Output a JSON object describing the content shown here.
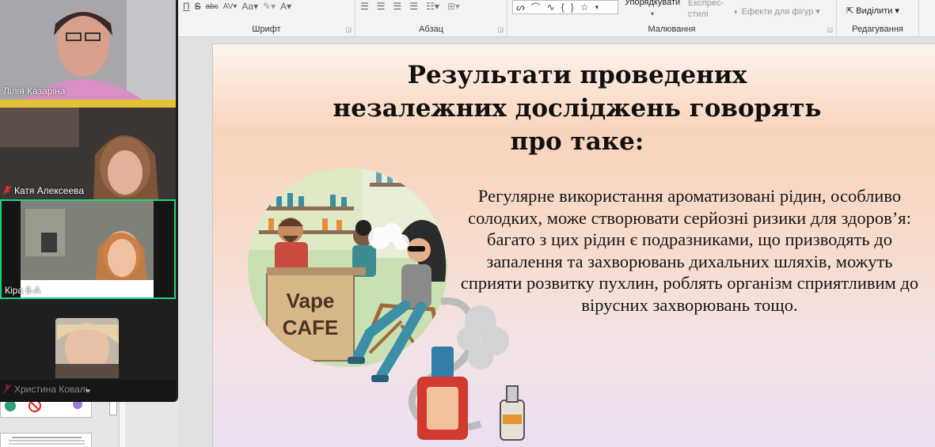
{
  "ribbon": {
    "font_group_label": "Шрифт",
    "paragraph_group_label": "Абзац",
    "drawing_group_label": "Малювання",
    "editing_group_label": "Редагування",
    "arrange_label": "Упорядкувати",
    "express_styles_label": "Експрес-стилі",
    "shape_effects_label": "Ефекти для фігур",
    "select_label": "Виділити"
  },
  "slide": {
    "title_lines": [
      "Результати проведених",
      "незалежних досліджень говорять",
      "про таке:"
    ],
    "body": "Регулярне використання ароматизовані рідин, особливо солодких, може створювати серйозні ризики для здоров’я: багато з цих рідин є подразниками, що призводять до запалення та захворювань дихальних шляхів, можуть сприяти розвитку пухлин, роблять організм сприятливим до вірусних захворювань тощо.",
    "sign_line1": "Vape",
    "sign_line2": "CAFE"
  },
  "participants": [
    {
      "name": "Лілія Казаріна",
      "muted": false
    },
    {
      "name": "Катя Алексеева",
      "muted": true
    },
    {
      "name": "Кіра 6-А",
      "muted": false,
      "active": true
    },
    {
      "name": "Христина Коваль",
      "muted": true
    }
  ],
  "colors": {
    "active_border": "#1ed47a",
    "muted_red": "#e0322b",
    "panel_bg": "#1f1f1f"
  }
}
